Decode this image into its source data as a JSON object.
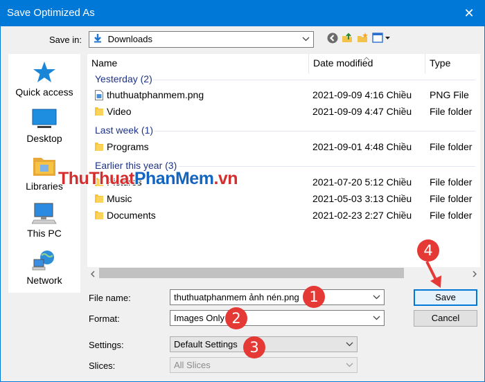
{
  "window": {
    "title": "Save Optimized As",
    "close_glyph": "✕"
  },
  "save_in": {
    "label": "Save in:",
    "value": "Downloads"
  },
  "places": [
    {
      "label": "Quick access",
      "icon": "star-icon"
    },
    {
      "label": "Desktop",
      "icon": "desktop-icon"
    },
    {
      "label": "Libraries",
      "icon": "libraries-icon"
    },
    {
      "label": "This PC",
      "icon": "computer-icon"
    },
    {
      "label": "Network",
      "icon": "network-icon"
    }
  ],
  "columns": {
    "name": "Name",
    "date": "Date modified",
    "type": "Type"
  },
  "groups": [
    {
      "title": "Yesterday (2)",
      "rows": [
        {
          "name": "thuthuatphanmem.png",
          "date": "2021-09-09 4:16 Chiều",
          "type": "PNG File",
          "icon": "image-file-icon"
        },
        {
          "name": "Video",
          "date": "2021-09-09 4:47 Chiều",
          "type": "File folder",
          "icon": "folder-icon"
        }
      ]
    },
    {
      "title": "Last week (1)",
      "rows": [
        {
          "name": "Programs",
          "date": "2021-09-01 4:48 Chiều",
          "type": "File folder",
          "icon": "folder-icon"
        }
      ]
    },
    {
      "title": "Earlier this year (3)",
      "rows": [
        {
          "name": "Pictures",
          "date": "2021-07-20 5:12 Chiều",
          "type": "File folder",
          "icon": "folder-icon"
        },
        {
          "name": "Music",
          "date": "2021-05-03 3:13 Chiều",
          "type": "File folder",
          "icon": "folder-icon"
        },
        {
          "name": "Documents",
          "date": "2021-02-23 2:27 Chiều",
          "type": "File folder",
          "icon": "folder-icon"
        }
      ]
    }
  ],
  "form": {
    "file_name_label": "File name:",
    "file_name_value": "thuthuatphanmem ảnh nén.png",
    "format_label": "Format:",
    "format_value": "Images Only",
    "settings_label": "Settings:",
    "settings_value": "Default Settings",
    "slices_label": "Slices:",
    "slices_value": "All Slices"
  },
  "buttons": {
    "save": "Save",
    "cancel": "Cancel"
  },
  "annotations": {
    "b1": "1",
    "b2": "2",
    "b3": "3",
    "b4": "4"
  },
  "watermark": {
    "part1": "ThuThuat",
    "part2": "PhanMem",
    "part3": ".vn"
  },
  "colors": {
    "accent": "#0078d7",
    "badge": "#e53935",
    "group_text": "#1e3287",
    "folder": "#f8c53a"
  }
}
